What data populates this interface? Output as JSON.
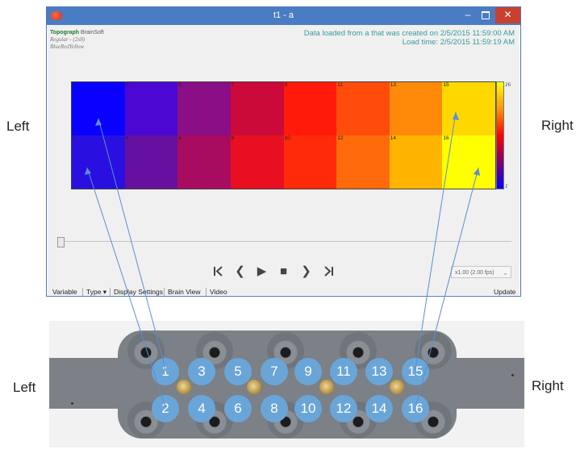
{
  "labels": {
    "left_top": "Left",
    "right_top": "Right",
    "left_bottom": "Left",
    "right_bottom": "Right"
  },
  "window": {
    "title": "t1 - a",
    "controls": {
      "minimize": "–",
      "close": "✕"
    },
    "brand": {
      "name": "Topograph",
      "company": "BrainSoft",
      "line2": "Regular - (2x8)",
      "line3": "BlueRedYellow"
    },
    "info_line1": "Data loaded from a that was created on 2/5/2015 11:59:00 AM",
    "info_line2": "Load time: 2/5/2015 11:59:19 AM"
  },
  "heatmap": {
    "rows": [
      [
        {
          "n": "1",
          "color": "#0a00ff"
        },
        {
          "n": "3",
          "color": "#4a08d2"
        },
        {
          "n": "5",
          "color": "#8a0e85"
        },
        {
          "n": "7",
          "color": "#cc0a3a"
        },
        {
          "n": "9",
          "color": "#ff1a0a"
        },
        {
          "n": "11",
          "color": "#ff4c0a"
        },
        {
          "n": "13",
          "color": "#ff8a0a"
        },
        {
          "n": "15",
          "color": "#ffd800"
        }
      ],
      [
        {
          "n": "2",
          "color": "#2a10e0"
        },
        {
          "n": "4",
          "color": "#66109f"
        },
        {
          "n": "6",
          "color": "#a80c60"
        },
        {
          "n": "8",
          "color": "#e81020"
        },
        {
          "n": "10",
          "color": "#ff2a0a"
        },
        {
          "n": "12",
          "color": "#ff6a0a"
        },
        {
          "n": "14",
          "color": "#ffb400"
        },
        {
          "n": "16",
          "color": "#ffff00"
        }
      ]
    ],
    "colorbar_max": "16",
    "colorbar_min": "1"
  },
  "playback": {
    "first": "K",
    "prev": "❮",
    "play": "▶",
    "stop": "■",
    "next": "❯",
    "last": "›|",
    "speed": "x1.00 (2.00 fps)",
    "speed_caret": "⌄"
  },
  "toolbar": {
    "variable": "Variable",
    "type": "Type ▾",
    "display": "Display Settings",
    "brain": "Brain View",
    "video": "Video",
    "update": "Update"
  },
  "electrodes": [
    "1",
    "2",
    "3",
    "4",
    "5",
    "6",
    "7",
    "8",
    "9",
    "10",
    "11",
    "12",
    "13",
    "14",
    "15",
    "16"
  ],
  "colors": {
    "electrode": "#6aa5d8",
    "titlebar": "#4a7cc4",
    "close": "#c9402e",
    "lines": "#5b8fd1"
  }
}
